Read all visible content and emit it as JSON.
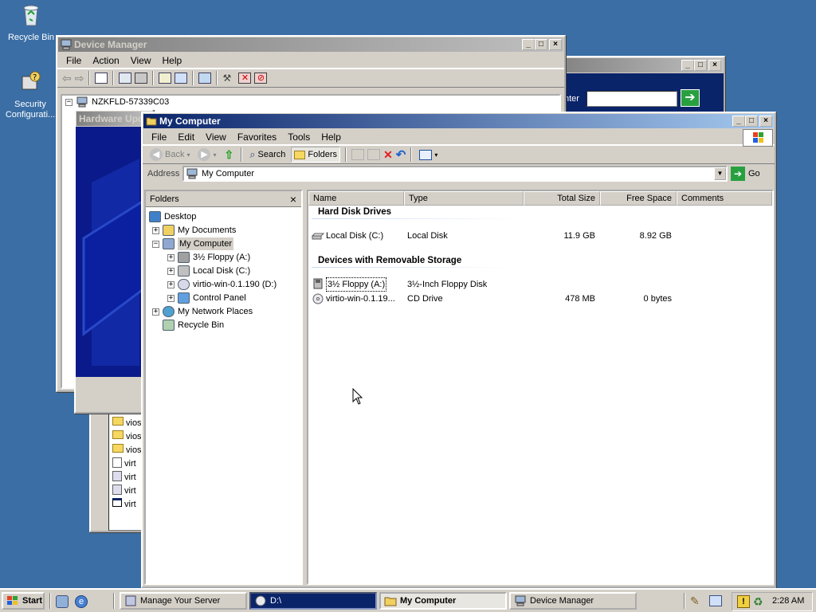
{
  "desktop": {
    "icons": [
      {
        "label": "Recycle Bin"
      },
      {
        "label": "Security Configurati..."
      }
    ]
  },
  "back_window": {
    "search_placeholder": "nter"
  },
  "device_manager": {
    "title": "Device Manager",
    "menu": [
      "File",
      "Action",
      "View",
      "Help"
    ],
    "tree_root": "NZKFLD-57339C03"
  },
  "hardware_update": {
    "title": "Hardware Upd"
  },
  "back_list": {
    "items": [
      "vios",
      "vios",
      "vios",
      "virt",
      "virt",
      "virt",
      "virt"
    ]
  },
  "my_computer": {
    "title": "My Computer",
    "menu": [
      "File",
      "Edit",
      "View",
      "Favorites",
      "Tools",
      "Help"
    ],
    "toolbar": {
      "back": "Back",
      "search": "Search",
      "folders": "Folders"
    },
    "address": {
      "label": "Address",
      "value": "My Computer",
      "go": "Go"
    },
    "folders_pane": {
      "title": "Folders",
      "close": "×",
      "tree": [
        {
          "label": "Desktop",
          "level": 0,
          "expander": ""
        },
        {
          "label": "My Documents",
          "level": 1,
          "expander": "+"
        },
        {
          "label": "My Computer",
          "level": 1,
          "expander": "−",
          "selected": true
        },
        {
          "label": "3½ Floppy (A:)",
          "level": 2,
          "expander": "+"
        },
        {
          "label": "Local Disk (C:)",
          "level": 2,
          "expander": "+"
        },
        {
          "label": "virtio-win-0.1.190 (D:)",
          "level": 2,
          "expander": "+"
        },
        {
          "label": "Control Panel",
          "level": 2,
          "expander": "+"
        },
        {
          "label": "My Network Places",
          "level": 1,
          "expander": "+"
        },
        {
          "label": "Recycle Bin",
          "level": 1,
          "expander": ""
        }
      ]
    },
    "columns": [
      "Name",
      "Type",
      "Total Size",
      "Free Space",
      "Comments"
    ],
    "groups": [
      {
        "title": "Hard Disk Drives",
        "rows": [
          {
            "name": "Local Disk (C:)",
            "type": "Local Disk",
            "total": "11.9 GB",
            "free": "8.92 GB",
            "comments": ""
          }
        ]
      },
      {
        "title": "Devices with Removable Storage",
        "rows": [
          {
            "name": "3½ Floppy (A:)",
            "type": "3½-Inch Floppy Disk",
            "total": "",
            "free": "",
            "comments": ""
          },
          {
            "name": "virtio-win-0.1.19...",
            "type": "CD Drive",
            "total": "478 MB",
            "free": "0 bytes",
            "comments": ""
          }
        ]
      }
    ]
  },
  "taskbar": {
    "start": "Start",
    "tasks": [
      "Manage Your Server",
      "D:\\",
      "My Computer",
      "Device Manager"
    ],
    "clock": "2:28 AM"
  }
}
